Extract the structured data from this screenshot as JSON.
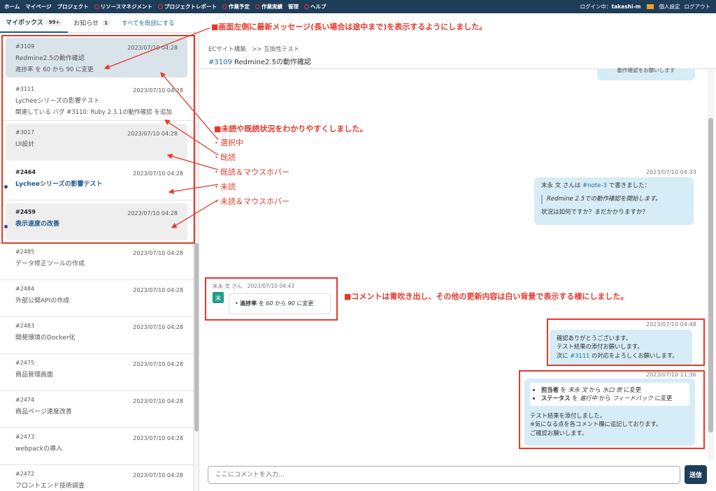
{
  "topbar": {
    "nav": [
      "ホーム",
      "マイページ",
      "プロジェクト",
      "リソースマネジメント",
      "プロジェクトレポート",
      "作業予定",
      "作業実績",
      "管理",
      "ヘルプ"
    ],
    "login_label": "ログイン中：",
    "user": "takashi-m",
    "settings": "個人設定",
    "logout": "ログアウト"
  },
  "tabs": {
    "mailbox": "マイボックス",
    "mailbox_count": "99+",
    "notice": "お知らせ",
    "notice_count": "1",
    "mark_all": "すべてを既読にする"
  },
  "messages": [
    {
      "id": "#3109",
      "date": "2023/07/10 04:28",
      "subject": "Redmine2.5の動作確認",
      "body": "進捗率 を 60 から 90 に変更"
    },
    {
      "id": "#3111",
      "date": "2023/07/10 04:28",
      "subject": "Lycheeシリーズの影響テスト",
      "body": "関連している バグ #3110: Ruby 2.3.1の動作確認 を追加"
    },
    {
      "id": "#3017",
      "date": "2023/07/10 04:28",
      "subject": "UI設計",
      "body": ""
    },
    {
      "id": "#2464",
      "date": "2023/07/10 04:28",
      "subject": "Lycheeシリーズの影響テスト",
      "body": ""
    },
    {
      "id": "#2459",
      "date": "2023/07/10 04:28",
      "subject": "表示速度の改善",
      "body": ""
    },
    {
      "id": "#2485",
      "date": "2023/07/10 04:28",
      "subject": "データ修正ツールの作成",
      "body": ""
    },
    {
      "id": "#2484",
      "date": "2023/07/10 04:28",
      "subject": "外部公開APIの作成",
      "body": ""
    },
    {
      "id": "#2483",
      "date": "2023/07/10 04:28",
      "subject": "開発環境のDocker化",
      "body": ""
    },
    {
      "id": "#2475",
      "date": "2023/07/10 04:28",
      "subject": "商品管理画面",
      "body": ""
    },
    {
      "id": "#2474",
      "date": "2023/07/10 04:28",
      "subject": "商品ページ速度改善",
      "body": ""
    },
    {
      "id": "#2473",
      "date": "2023/07/10 04:28",
      "subject": "webpackの導入",
      "body": ""
    },
    {
      "id": "#2472",
      "date": "2023/07/10 04:28",
      "subject": "フロントエンド技術調査",
      "body": ""
    }
  ],
  "issue": {
    "breadcrumb": "ECサイト構築　>> 互換性テスト",
    "number": "#3109",
    "title": "Redmine2.5の動作確認"
  },
  "thread": {
    "b0": "動作確認をお願いします",
    "m1": "2023/07/10 04:33",
    "b1_a": "末永 文 さんは",
    "b1_link": "#note-3",
    "b1_b": "で書きました：",
    "b1_quote": "Redmine 2.5での動作確認を開始します。",
    "b1_c": "状況は如何ですか？まだかかりますか？",
    "sys_meta": "末永 文 さん　2023/07/10 04:43",
    "avatar": "末",
    "sys_field": "進捗率",
    "sys_text_a": "を",
    "sys_from": "60",
    "sys_text_b": "から",
    "sys_to": "90",
    "sys_text_c": "に変更",
    "m2": "2023/07/10 04:48",
    "b2_l1": "確認ありがとうございます。",
    "b2_l2": "テスト結果の添付お願いします。",
    "b2_l3a": "次に",
    "b2_link": "#3111",
    "b2_l3b": "の対応をよろしくお願いします。",
    "m3": "2023/07/10 11:36",
    "b3_f1": "担当者",
    "b3_f1a": "を",
    "b3_f1from": "末永 文",
    "b3_f1b": "から",
    "b3_f1to": "水口 崇",
    "b3_f1c": "に変更",
    "b3_f2": "ステータス",
    "b3_f2a": "を",
    "b3_f2from": "進行中",
    "b3_f2b": "から",
    "b3_f2to": "フィードバック",
    "b3_f2c": "に変更",
    "b3_l1": "テスト結果を添付しました。",
    "b3_l2": "※気になる点を各コメント欄に追記しております。",
    "b3_l3": "ご確認お願いします。"
  },
  "composer": {
    "placeholder": "ここにコメントを入力…",
    "send": "送信"
  },
  "annotations": {
    "a1": "■画面左側に最新メッセージ(長い場合は途中まで)を表示するようにしました。",
    "a2": "■未読や既読状況をわかりやすくしました。",
    "s1": "選択中",
    "s2": "既読",
    "s3": "既読＆マウスホバー",
    "s4": "未読",
    "s5": "未読＆マウスホバー",
    "a3": "■コメントは青吹き出し、その他の更新内容は白い背景で表示する様にしました。"
  }
}
